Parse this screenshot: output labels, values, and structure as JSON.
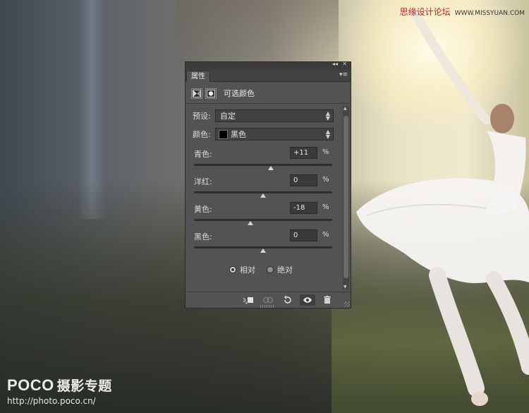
{
  "panel": {
    "tab_label": "属性",
    "collapse_icon": "double-left-arrow",
    "close_icon": "close-x",
    "header": {
      "title": "可选颜色",
      "icons": [
        "selective-color-adjustment-icon",
        "layer-mask-icon"
      ]
    },
    "preset": {
      "label": "预设:",
      "value": "自定"
    },
    "colors": {
      "label": "颜色:",
      "value": "黑色",
      "swatch": "#000000"
    },
    "sliders": [
      {
        "label": "青色:",
        "value": "+11",
        "unit": "%",
        "level": 11
      },
      {
        "label": "洋红:",
        "value": "0",
        "unit": "%",
        "level": 0
      },
      {
        "label": "黄色:",
        "value": "-18",
        "unit": "%",
        "level": -18
      },
      {
        "label": "黑色:",
        "value": "0",
        "unit": "%",
        "level": 0
      }
    ],
    "method": {
      "relative": "相对",
      "absolute": "绝对",
      "selected": "relative"
    },
    "footer_icons": [
      "clip-to-layer-icon",
      "view-previous-state-icon",
      "reset-icon",
      "visibility-eye-icon",
      "trash-icon"
    ]
  },
  "watermarks": {
    "top_cn": "思缘设计论坛",
    "top_en": "WWW.MISSYUAN.COM",
    "bottom_logo": "POCO",
    "bottom_sub": "摄影专题",
    "bottom_url": "http://photo.poco.cn/"
  },
  "colors": {
    "panel_bg": "#535353",
    "panel_dark": "#424242",
    "text": "#dcdcdc"
  }
}
